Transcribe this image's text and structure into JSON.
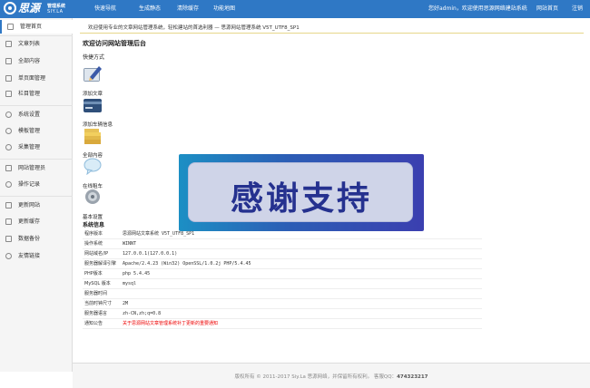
{
  "brand": {
    "name": "思源",
    "subtitle": "管理系统",
    "english": "SIY.LA"
  },
  "topnav": [
    {
      "label": "快速导航"
    },
    {
      "label": "生成静态"
    },
    {
      "label": "清除缓存"
    },
    {
      "label": "功能地图"
    }
  ],
  "topright": {
    "greeting": "您好admin，欢迎使用思源网络建站系统",
    "site_home": "网站首页",
    "logout": "注销"
  },
  "sidebar": {
    "items": [
      {
        "label": "管理首页"
      },
      {
        "label": "文章列表"
      },
      {
        "label": "全部内容"
      },
      {
        "label": "单页面管理"
      },
      {
        "label": "栏目管理"
      },
      {
        "label": "系统设置"
      },
      {
        "label": "模板管理"
      },
      {
        "label": "采集管理"
      },
      {
        "label": "网站管理员"
      },
      {
        "label": "操作记录"
      },
      {
        "label": "更新网站"
      },
      {
        "label": "更新缓存"
      },
      {
        "label": "数据备份"
      },
      {
        "label": "友情链接"
      }
    ]
  },
  "main": {
    "welcome": "欢迎使用专业的文章网站管理系统，轻松建站的首选利器 — 思源网站管理系统 V5T_UTF8_SP1",
    "title": "欢迎访问网站管理后台",
    "quick_title": "快捷方式",
    "quick": [
      {
        "label": "添加文章",
        "icon": "pencil-icon"
      },
      {
        "label": "添加车辆信息",
        "icon": "card-icon"
      },
      {
        "label": "全部内容",
        "icon": "folder-icon"
      },
      {
        "label": "在线租车",
        "icon": "chat-icon"
      },
      {
        "label": "基本设置",
        "icon": "gear-icon"
      }
    ],
    "sysinfo_title": "系统信息",
    "sysinfo": [
      {
        "k": "程序版本",
        "v": "思源网站文章系统 V5T_UTF8_SP1"
      },
      {
        "k": "操作系统",
        "v": "WINNT"
      },
      {
        "k": "网站域名/IP",
        "v": "127.0.0.1(127.0.0.1)"
      },
      {
        "k": "服务器解译引擎",
        "v": "Apache/2.4.23 (Win32) OpenSSL/1.0.2j PHP/5.4.45"
      },
      {
        "k": "PHP版本",
        "v": "php 5.4.45"
      },
      {
        "k": "MySQL 版本",
        "v": "mysql"
      },
      {
        "k": "服务器时间",
        "v": ""
      },
      {
        "k": "当前时钟尺寸",
        "v": "2M"
      },
      {
        "k": "服务器语言",
        "v": "zh-CN,zh;q=0.8"
      },
      {
        "k": "通知公告",
        "v": "关于思源网站文章管理系统补丁更新的重要通知"
      }
    ]
  },
  "overlay": {
    "text": "感谢支持"
  },
  "footer": {
    "copyright": "版权所有 © 2011-2017 Siy.La 思源网络，并保留所有权利。",
    "qq_label": "客服QQ：",
    "qq": "474323217"
  }
}
